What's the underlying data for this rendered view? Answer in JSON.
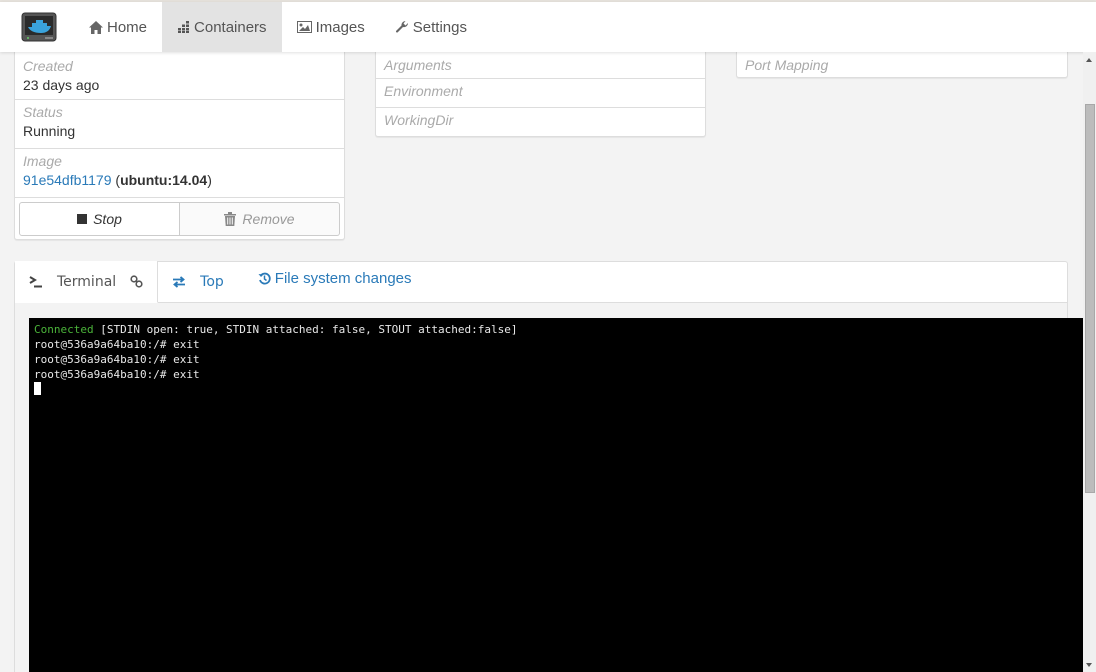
{
  "navbar": {
    "logo": "docker-monitor-logo",
    "items": [
      {
        "label": "Home",
        "icon": "home-icon",
        "active": false
      },
      {
        "label": "Containers",
        "icon": "containers-icon",
        "active": true
      },
      {
        "label": "Images",
        "icon": "image-icon",
        "active": false
      },
      {
        "label": "Settings",
        "icon": "wrench-icon",
        "active": false
      }
    ]
  },
  "details": {
    "created_label": "Created",
    "created_value": "23 days ago",
    "status_label": "Status",
    "status_value": "Running",
    "image_label": "Image",
    "image_id": "91e54dfb1179",
    "image_open": " (",
    "image_tag": "ubuntu:14.04",
    "image_close": ")",
    "stop_label": "Stop",
    "remove_label": "Remove"
  },
  "config": {
    "arguments_label": "Arguments",
    "environment_label": "Environment",
    "workingdir_label": "WorkingDir"
  },
  "ports": {
    "port_mapping_label": "Port Mapping"
  },
  "tabs": [
    {
      "label": "Terminal",
      "icon": "terminal-icon",
      "extra_icon": "link-icon",
      "active": true
    },
    {
      "label": "Top",
      "icon": "exchange-icon",
      "active": false
    },
    {
      "label": "File system changes",
      "icon": "history-icon",
      "active": false
    }
  ],
  "terminal": {
    "connected": "Connected",
    "status_line": " [STDIN open: true, STDIN attached: false, STOUT attached:false]",
    "lines": [
      "root@536a9a64ba10:/# exit",
      "root@536a9a64ba10:/# exit",
      "root@536a9a64ba10:/# exit"
    ]
  }
}
